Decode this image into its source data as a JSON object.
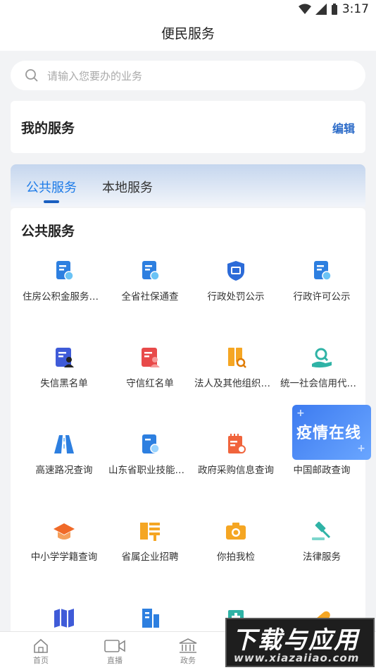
{
  "status": {
    "time": "3:17"
  },
  "header": {
    "title": "便民服务"
  },
  "search": {
    "placeholder": "请输入您要办的业务"
  },
  "my_service": {
    "title": "我的服务",
    "edit": "编辑"
  },
  "tabs": [
    {
      "label": "公共服务"
    },
    {
      "label": "本地服务"
    }
  ],
  "section": {
    "title": "公共服务"
  },
  "services": [
    {
      "label": "住房公积金服务大厅",
      "icon": "certificate-icon"
    },
    {
      "label": "全省社保通查",
      "icon": "certificate-icon"
    },
    {
      "label": "行政处罚公示",
      "icon": "penalty-shield-icon"
    },
    {
      "label": "行政许可公示",
      "icon": "certificate-icon"
    },
    {
      "label": "失信黑名单",
      "icon": "blacklist-icon"
    },
    {
      "label": "守信红名单",
      "icon": "redlist-icon"
    },
    {
      "label": "法人及其他组织信用信息",
      "icon": "org-search-icon"
    },
    {
      "label": "统一社会信用代码查询",
      "icon": "credit-hand-icon"
    },
    {
      "label": "高速路况查询",
      "icon": "road-icon"
    },
    {
      "label": "山东省职业技能证书查询",
      "icon": "skill-cert-icon"
    },
    {
      "label": "政府采购信息查询",
      "icon": "purchase-icon"
    },
    {
      "label": "中国邮政查询",
      "icon": "banner"
    },
    {
      "label": "中小学学籍查询",
      "icon": "graduation-cap-icon"
    },
    {
      "label": "省属企业招聘",
      "icon": "hire-icon"
    },
    {
      "label": "你拍我检",
      "icon": "camera-icon"
    },
    {
      "label": "法律服务",
      "icon": "gavel-icon"
    }
  ],
  "banner": {
    "text": "疫情在线"
  },
  "bottom_nav": [
    {
      "label": "首页"
    },
    {
      "label": "直播"
    },
    {
      "label": "政务"
    }
  ],
  "watermark": {
    "line1": "下载与应用",
    "line2": "www.xiazaiiao.com"
  },
  "colors": {
    "accent": "#1d7be8",
    "edit": "#2c6bc8"
  }
}
